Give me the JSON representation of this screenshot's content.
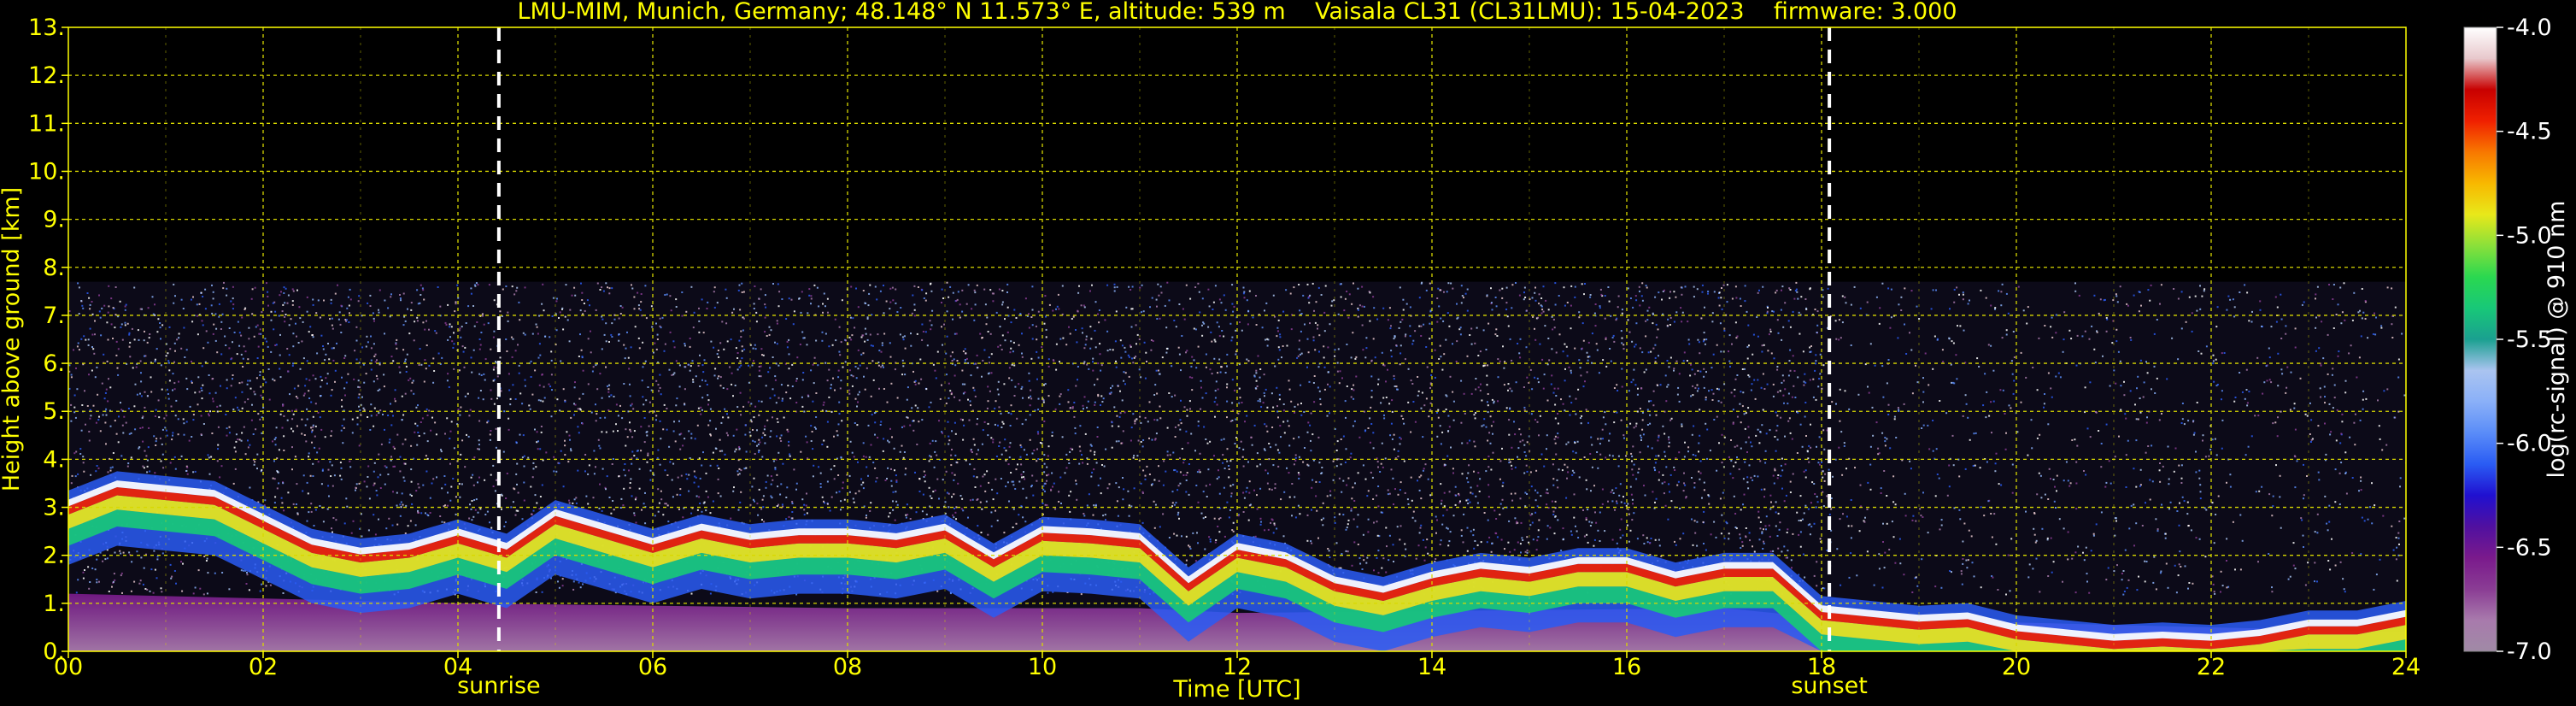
{
  "chart_data": {
    "type": "heatmap",
    "title": "LMU-MIM, Munich, Germany; 48.148° N 11.573° E, altitude: 539 m    Vaisala CL31 (CL31LMU): 15-04-2023    firmware: 3.000",
    "xlabel": "Time [UTC]",
    "ylabel": "Height above ground [km]",
    "xlim": [
      0,
      24
    ],
    "ylim": [
      0,
      13
    ],
    "x_ticks": [
      "00",
      "02",
      "04",
      "06",
      "08",
      "10",
      "12",
      "14",
      "16",
      "18",
      "20",
      "22",
      "24"
    ],
    "x_tick_values": [
      0,
      2,
      4,
      6,
      8,
      10,
      12,
      14,
      16,
      18,
      20,
      22,
      24
    ],
    "y_ticks": [
      "0.",
      "1.",
      "2.",
      "3.",
      "4.",
      "5.",
      "6.",
      "7.",
      "8.",
      "9.",
      "10.",
      "11.",
      "12.",
      "13."
    ],
    "y_tick_values": [
      0,
      1,
      2,
      3,
      4,
      5,
      6,
      7,
      8,
      9,
      10,
      11,
      12,
      13
    ],
    "grid": true,
    "markers": [
      {
        "label": "sunrise",
        "x": 4.42
      },
      {
        "label": "sunset",
        "x": 18.08
      }
    ],
    "colorbar": {
      "label": "log(rc-signal) @ 910 nm",
      "range": [
        -7.0,
        -4.0
      ],
      "ticks": [
        "-4.0",
        "-4.5",
        "-5.0",
        "-5.5",
        "-6.0",
        "-6.5",
        "-7.0"
      ],
      "tick_values": [
        -4.0,
        -4.5,
        -5.0,
        -5.5,
        -6.0,
        -6.5,
        -7.0
      ],
      "colors": [
        "#a08aa6",
        "#a87aac",
        "#8a3c94",
        "#7a1a8c",
        "#5010a0",
        "#2010d0",
        "#2a5cf4",
        "#5a8cf8",
        "#8ab0f8",
        "#aac4f0",
        "#1aa090",
        "#18c878",
        "#2ad850",
        "#8ae03a",
        "#e8e81a",
        "#f8b800",
        "#f87800",
        "#f02000",
        "#c80000",
        "#e8c8cc",
        "#ffffff"
      ]
    },
    "cloud_layer": {
      "name": "cloud top / layer height",
      "unit": "km",
      "t": [
        0,
        0.5,
        1,
        1.5,
        2,
        2.5,
        3,
        3.5,
        4,
        4.5,
        5,
        5.5,
        6,
        6.5,
        7,
        7.5,
        8,
        8.5,
        9,
        9.5,
        10,
        10.5,
        11,
        11.5,
        12,
        12.5,
        13,
        13.5,
        14,
        14.5,
        15,
        15.5,
        16,
        16.5,
        17,
        17.5,
        18,
        18.5,
        19,
        19.5,
        20,
        20.5,
        21,
        21.5,
        22,
        22.5,
        23,
        23.5,
        24
      ],
      "h": [
        3.1,
        3.5,
        3.4,
        3.3,
        2.8,
        2.3,
        2.1,
        2.2,
        2.5,
        2.2,
        2.9,
        2.6,
        2.3,
        2.6,
        2.4,
        2.5,
        2.5,
        2.4,
        2.6,
        2.0,
        2.55,
        2.5,
        2.4,
        1.5,
        2.2,
        2.0,
        1.5,
        1.3,
        1.6,
        1.8,
        1.7,
        1.9,
        1.9,
        1.6,
        1.8,
        1.8,
        0.9,
        0.8,
        0.7,
        0.75,
        0.5,
        0.4,
        0.3,
        0.35,
        0.3,
        0.4,
        0.6,
        0.6,
        0.8
      ]
    },
    "noise_top_km": 7.7
  }
}
